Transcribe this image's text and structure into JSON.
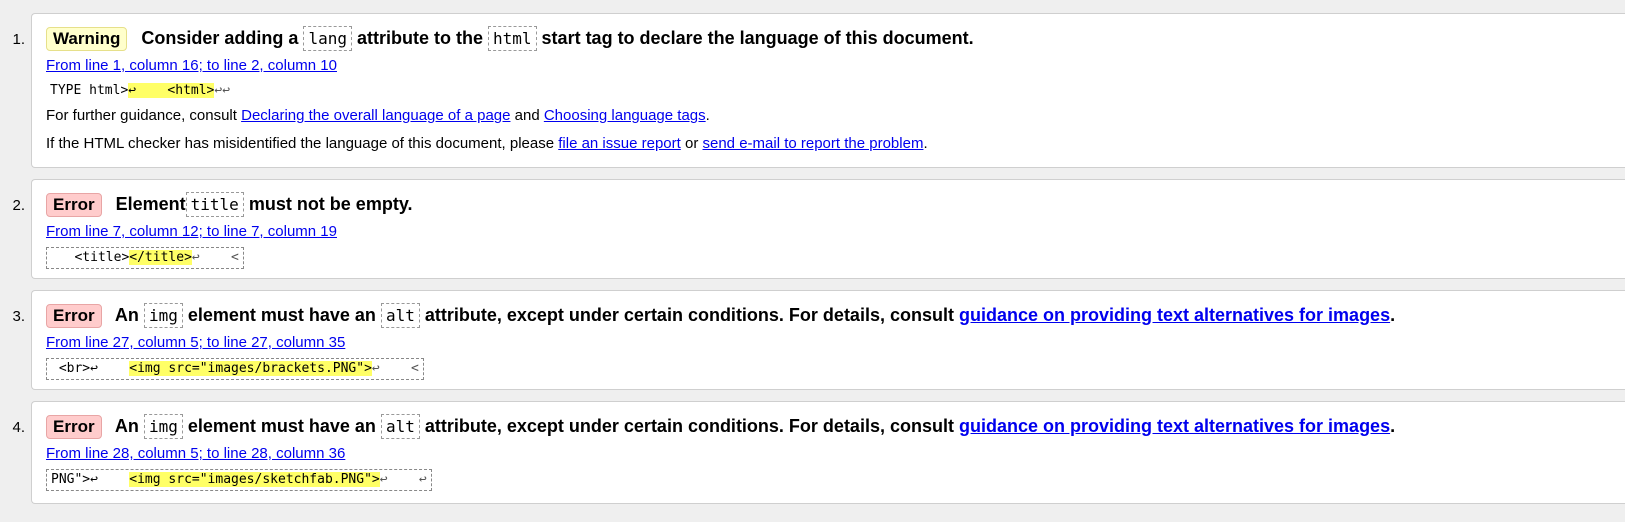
{
  "messages": [
    {
      "number": "1.",
      "badge": "Warning",
      "text_a": "Consider adding a",
      "code_a": "lang",
      "text_b": "attribute to the",
      "code_b": "html",
      "text_c": "start tag to declare the language of this document.",
      "location": "From line 1, column 16; to line 2, column 10",
      "extract_before": "TYPE html>",
      "extract_highlight": "↩    <html>",
      "extract_after": "↩↩",
      "guidance_prefix": "For further guidance, consult",
      "guidance_link1": "Declaring the overall language of a page",
      "guidance_mid": "and",
      "guidance_link2": "Choosing language tags",
      "guidance_end": ".",
      "report_prefix": "If the HTML checker has misidentified the language of this document, please",
      "report_link1": "file an issue report",
      "report_mid": "or",
      "report_link2": "send e-mail to report the problem",
      "report_end": "."
    },
    {
      "number": "2.",
      "badge": "Error",
      "text_a": "Element",
      "code_a": "title",
      "text_b": "must not be empty.",
      "location": "From line 7, column 12; to line 7, column 19",
      "extract_before": "   <title>",
      "extract_highlight": "</title>",
      "extract_after": "↩    <"
    },
    {
      "number": "3.",
      "badge": "Error",
      "text_a": "An",
      "code_a": "img",
      "text_b": "element must have an",
      "code_b": "alt",
      "text_c": "attribute, except under certain conditions. For details, consult",
      "link": "guidance on providing text alternatives for images",
      "text_end": ".",
      "location": "From line 27, column 5; to line 27, column 35",
      "extract_before": " <br>↩    ",
      "extract_highlight": "<img src=\"images/brackets.PNG\">",
      "extract_after": "↩    <"
    },
    {
      "number": "4.",
      "badge": "Error",
      "text_a": "An",
      "code_a": "img",
      "text_b": "element must have an",
      "code_b": "alt",
      "text_c": "attribute, except under certain conditions. For details, consult",
      "link": "guidance on providing text alternatives for images",
      "text_end": ".",
      "location": "From line 28, column 5; to line 28, column 36",
      "extract_before": "PNG\">↩    ",
      "extract_highlight": "<img src=\"images/sketchfab.PNG\">",
      "extract_after": "↩    ↩"
    }
  ],
  "colors": {
    "warning_badge": "#ffffcc",
    "error_badge": "#ffcccc",
    "link": "#0000ee",
    "highlight": "#ffff66"
  }
}
